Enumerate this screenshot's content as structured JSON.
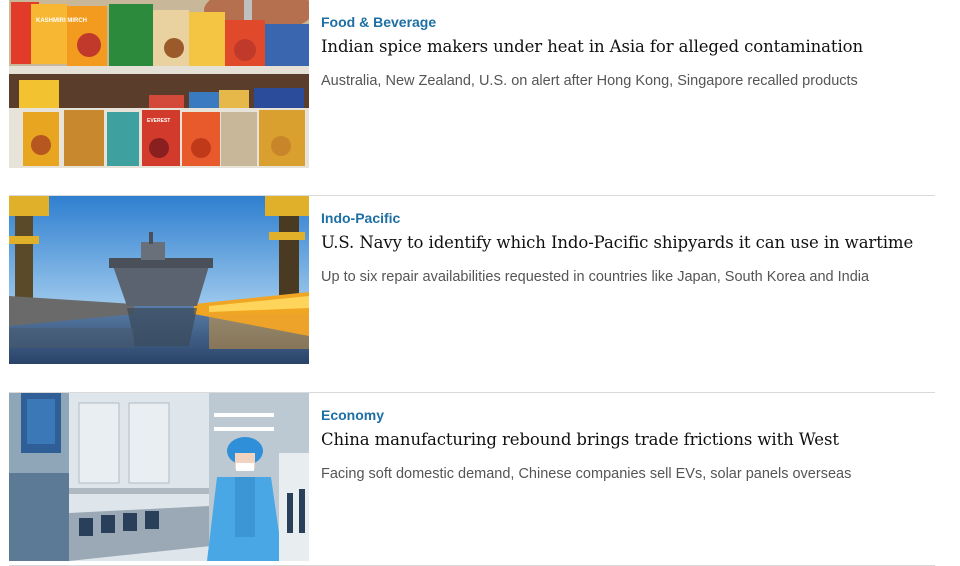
{
  "articles": [
    {
      "section": "Food & Beverage",
      "headline": "Indian spice makers under heat in Asia for alleged contamination",
      "subhead": "Australia, New Zealand, U.S. on alert after Hong Kong, Singapore recalled products",
      "image_label_top": "KASHMIRI MIRCH",
      "image_label_bottom": "EVEREST"
    },
    {
      "section": "Indo-Pacific",
      "headline": "U.S. Navy to identify which Indo-Pacific shipyards it can use in wartime",
      "subhead": "Up to six repair availabilities requested in countries like Japan, South Korea and India"
    },
    {
      "section": "Economy",
      "headline": "China manufacturing rebound brings trade frictions with West",
      "subhead": "Facing soft domestic demand, Chinese companies sell EVs, solar panels overseas"
    }
  ],
  "colors": {
    "section": "#1d6fa5",
    "headline": "#111111",
    "subhead": "#555555",
    "divider": "#d9d9d9"
  }
}
